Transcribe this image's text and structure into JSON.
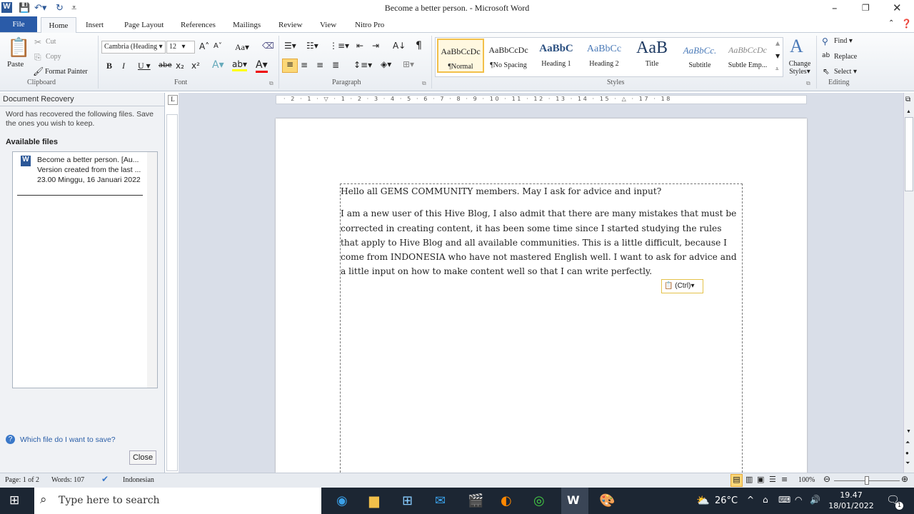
{
  "window": {
    "title": "Become a better person.  -  Microsoft Word",
    "app_icon": "W"
  },
  "tabs": [
    "File",
    "Home",
    "Insert",
    "Page Layout",
    "References",
    "Mailings",
    "Review",
    "View",
    "Nitro Pro"
  ],
  "clipboard": {
    "paste": "Paste",
    "cut": "Cut",
    "copy": "Copy",
    "format_painter": "Format Painter",
    "label": "Clipboard"
  },
  "font": {
    "name": "Cambria (Headings)",
    "display_name": "Cambria (Heading",
    "size": "12",
    "label": "Font",
    "change_case": "Aa"
  },
  "paragraph": {
    "label": "Paragraph"
  },
  "styles": {
    "label": "Styles",
    "items": [
      {
        "preview": "AaBbCcDc",
        "name": "¶Normal"
      },
      {
        "preview": "AaBbCcDc",
        "name": "¶No Spacing"
      },
      {
        "preview": "AaBbC",
        "name": "Heading 1"
      },
      {
        "preview": "AaBbCc",
        "name": "Heading 2"
      },
      {
        "preview": "AaB",
        "name": "Title"
      },
      {
        "preview": "AaBbCc.",
        "name": "Subtitle"
      },
      {
        "preview": "AaBbCcDc",
        "name": "Subtle Emp..."
      }
    ],
    "change_styles": "Change Styles"
  },
  "editing": {
    "label": "Editing",
    "find": "Find",
    "replace": "Replace",
    "select": "Select"
  },
  "recovery": {
    "title": "Document Recovery",
    "message": "Word has recovered the following files.  Save the ones you wish to keep.",
    "available": "Available files",
    "file_name": "Become a better person.  [Au...",
    "file_desc": "Version created from the last ...",
    "file_date": "23.00 Minggu, 16 Januari 2022",
    "help_link": "Which file do I want to save?",
    "close": "Close"
  },
  "ruler": "· 2 · 1 · ▽ · 1 · 2 · 3 · 4 · 5 · 6 · 7 · 8 · 9 · 10 · 11 · 12 · 13 · 14 · 15 · △ · 17 · 18",
  "document": {
    "heading": "Hello all GEMS COMMUNITY members. May I ask for advice and input?",
    "body": "I am a new user of this Hive Blog, I also admit that there are many mistakes that must be corrected in creating content, it has been some time since I started studying the rules that apply to Hive Blog and all available communities. This is a little difficult, because I come from INDONESIA who have not mastered English well. I want to ask for advice and a little  input on how to make content well so that I can write perfectly.",
    "paste_options": "(Ctrl)"
  },
  "status": {
    "page": "Page: 1 of 2",
    "words": "Words: 107",
    "language": "Indonesian",
    "zoom": "100%",
    "zoom_value": 100
  },
  "taskbar": {
    "search_placeholder": "Type here to search",
    "weather": "26°C",
    "time": "19.47",
    "date": "18/01/2022",
    "notifications": "1"
  },
  "colors": {
    "file_tab": "#2a5ba8",
    "taskbar": "#1c2633",
    "doc_bg": "#d9dee8"
  }
}
